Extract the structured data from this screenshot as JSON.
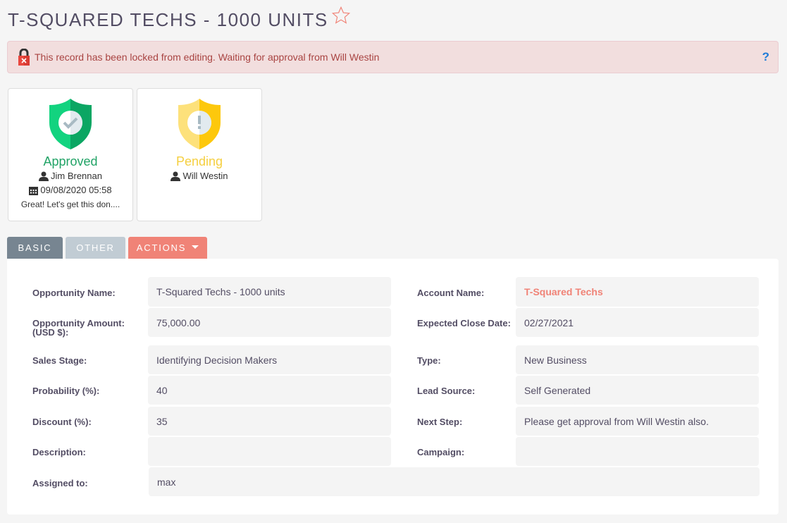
{
  "header": {
    "title": "T-SQUARED TECHS - 1000 UNITS",
    "favorite_icon": "star-outline-icon"
  },
  "alert": {
    "icon": "lock-icon",
    "message": "This record has been locked from editing. Waiting for approval from Will Westin",
    "help_icon": "?"
  },
  "approvals": [
    {
      "status": "Approved",
      "icon": "shield-check-icon",
      "user": "Jim Brennan",
      "date": "09/08/2020 05:58",
      "comment": "Great! Let's get this don....",
      "color": "#21a366"
    },
    {
      "status": "Pending",
      "icon": "shield-exclamation-icon",
      "user": "Will Westin",
      "color": "#f5cf3f"
    }
  ],
  "tabs": [
    {
      "label": "BASIC",
      "active": true
    },
    {
      "label": "OTHER",
      "active": false
    },
    {
      "label": "ACTIONS",
      "dropdown": true
    }
  ],
  "fields": {
    "opportunity_name": {
      "label": "Opportunity Name:",
      "value": "T-Squared Techs - 1000 units"
    },
    "opportunity_amount": {
      "label": "Opportunity Amount:",
      "label2": "(USD $):",
      "value": "75,000.00"
    },
    "sales_stage": {
      "label": "Sales Stage:",
      "value": "Identifying Decision Makers"
    },
    "probability": {
      "label": "Probability (%):",
      "value": "40"
    },
    "discount": {
      "label": "Discount (%):",
      "value": "35"
    },
    "description": {
      "label": "Description:",
      "value": ""
    },
    "assigned_to": {
      "label": "Assigned to:",
      "value": "max"
    },
    "account_name": {
      "label": "Account Name:",
      "value": "T-Squared Techs"
    },
    "expected_close_date": {
      "label": "Expected Close Date:",
      "value": "02/27/2021"
    },
    "type": {
      "label": "Type:",
      "value": "New Business"
    },
    "lead_source": {
      "label": "Lead Source:",
      "value": "Self Generated"
    },
    "next_step": {
      "label": "Next Step:",
      "value": "Please get approval from Will Westin also."
    },
    "campaign": {
      "label": "Campaign:",
      "value": ""
    }
  },
  "colors": {
    "accent": "#f08377",
    "alert_bg": "#f2dede",
    "alert_text": "#a94442",
    "tab_active": "#778591",
    "tab_inactive": "#c1ccd4"
  }
}
